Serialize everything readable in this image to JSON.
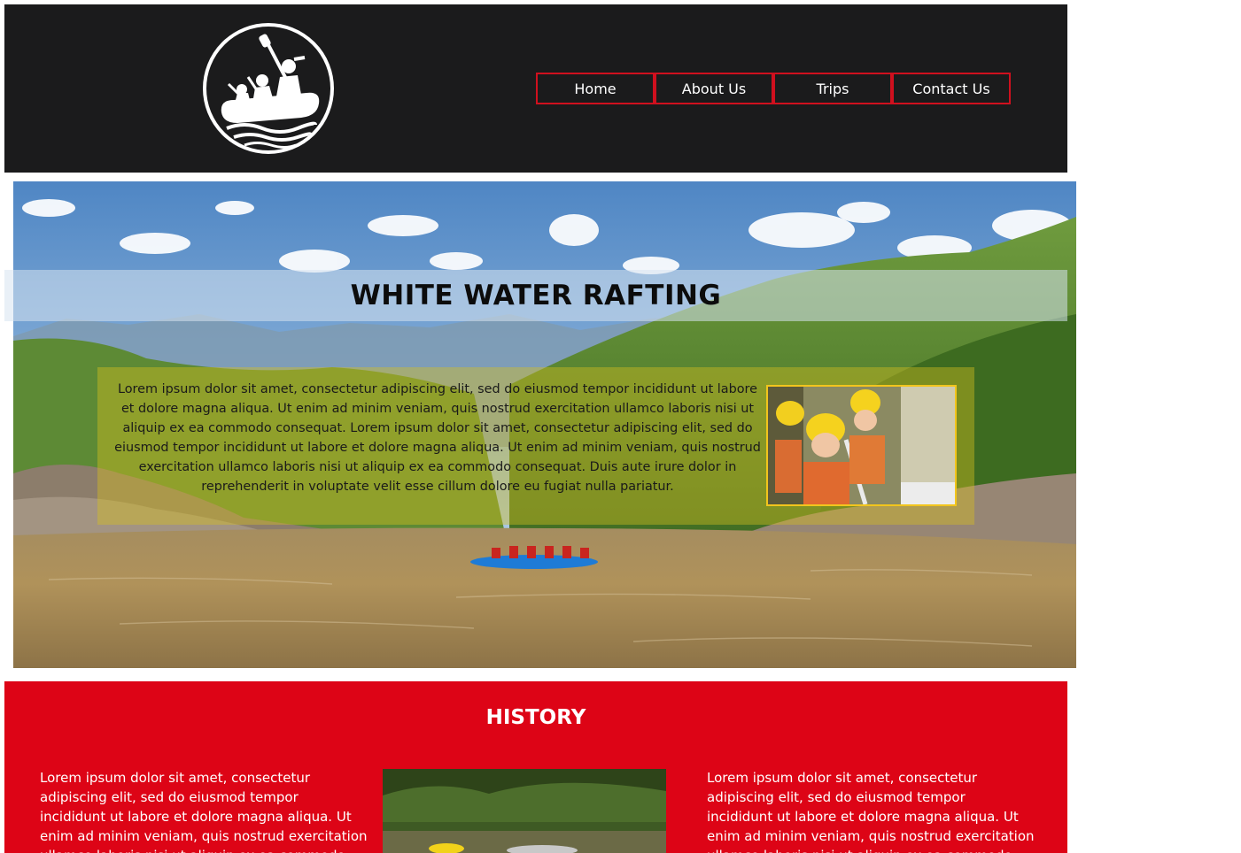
{
  "header": {
    "logo_icon": "rafting-logo-icon",
    "nav": [
      {
        "label": "Home"
      },
      {
        "label": "About Us"
      },
      {
        "label": "Trips"
      },
      {
        "label": "Contact Us"
      }
    ],
    "colors": {
      "background": "#1b1b1c",
      "nav_border": "#d0101e"
    }
  },
  "hero": {
    "title": "WHITE WATER RAFTING",
    "text": "Lorem ipsum dolor sit amet, consectetur adipiscing elit, sed do eiusmod tempor incididunt ut labore et dolore magna aliqua. Ut enim ad minim veniam, quis nostrud exercitation ullamco laboris nisi ut aliquip ex ea commodo consequat. Lorem ipsum dolor sit amet, consectetur adipiscing elit, sed do eiusmod tempor incididunt ut labore et dolore magna aliqua. Ut enim ad minim veniam, quis nostrud exercitation ullamco laboris nisi ut aliquip ex ea commodo consequat. Duis aute irure dolor in reprehenderit in voluptate velit esse cillum dolore eu fugiat nulla pariatur.",
    "colors": {
      "panel_border": "#f2c51d"
    }
  },
  "history": {
    "title": "HISTORY",
    "left_text": "Lorem ipsum dolor sit amet, consectetur adipiscing elit, sed do eiusmod tempor incididunt ut labore et dolore magna aliqua. Ut enim ad minim veniam, quis nostrud exercitation ullamco laboris nisi ut aliquip ex ea commodo consequat.",
    "right_text": "Lorem ipsum dolor sit amet, consectetur adipiscing elit, sed do eiusmod tempor incididunt ut labore et dolore magna aliqua. Ut enim ad minim veniam, quis nostrud exercitation ullamco laboris nisi ut aliquip ex ea commodo consequat.",
    "colors": {
      "background": "#dd0416"
    }
  }
}
